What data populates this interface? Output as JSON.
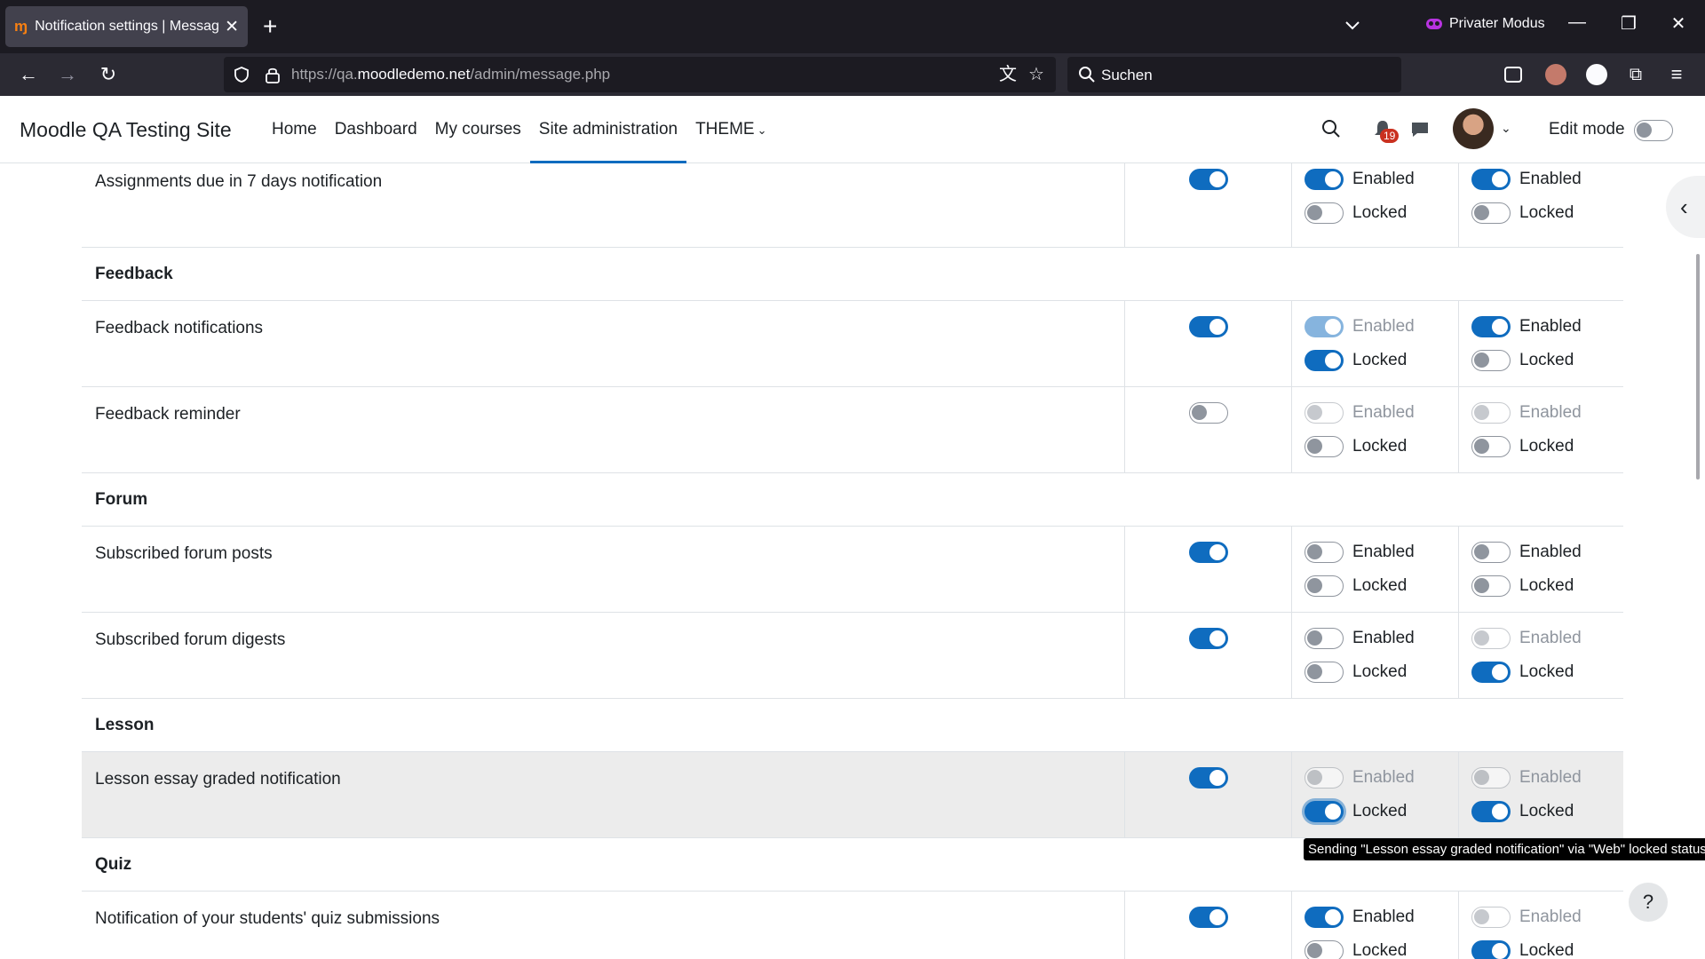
{
  "browser": {
    "tab_title": "Notification settings | Messagin",
    "tab_favicon": "moodle-m",
    "private_label": "Privater Modus",
    "url_prefix": "https://qa.",
    "url_domain": "moodledemo.net",
    "url_path": "/admin/message.php",
    "search_placeholder": "Suchen"
  },
  "moodle": {
    "site_name": "Moodle QA Testing Site",
    "nav": [
      "Home",
      "Dashboard",
      "My courses",
      "Site administration",
      "THEME"
    ],
    "active_nav": "Site administration",
    "notification_count": "19",
    "edit_mode_label": "Edit mode",
    "edit_mode_on": false
  },
  "labels": {
    "enabled": "Enabled",
    "locked": "Locked"
  },
  "rows": [
    {
      "type": "item",
      "label": "Assignments due in 7 days notification",
      "default": true,
      "p1": {
        "enabled": true,
        "locked": false,
        "disabled": false
      },
      "p2": {
        "enabled": true,
        "locked": false,
        "disabled": false
      }
    },
    {
      "type": "category",
      "label": "Feedback"
    },
    {
      "type": "item",
      "label": "Feedback notifications",
      "default": true,
      "p1": {
        "enabled": true,
        "locked": true,
        "disabled": true
      },
      "p2": {
        "enabled": true,
        "locked": false,
        "disabled": false
      }
    },
    {
      "type": "item",
      "label": "Feedback reminder",
      "default": false,
      "p1": {
        "enabled": false,
        "locked": false,
        "disabled": true
      },
      "p2": {
        "enabled": false,
        "locked": false,
        "disabled": true
      }
    },
    {
      "type": "category",
      "label": "Forum"
    },
    {
      "type": "item",
      "label": "Subscribed forum posts",
      "default": true,
      "p1": {
        "enabled": false,
        "locked": false,
        "disabled": false
      },
      "p2": {
        "enabled": false,
        "locked": false,
        "disabled": false
      }
    },
    {
      "type": "item",
      "label": "Subscribed forum digests",
      "default": true,
      "p1": {
        "enabled": false,
        "locked": false,
        "disabled": false
      },
      "p2": {
        "enabled": false,
        "locked": true,
        "disabled": true
      }
    },
    {
      "type": "category",
      "label": "Lesson"
    },
    {
      "type": "item",
      "label": "Lesson essay graded notification",
      "default": true,
      "hover": true,
      "p1": {
        "enabled": false,
        "locked": true,
        "disabled": true,
        "focus": true
      },
      "p2": {
        "enabled": false,
        "locked": true,
        "disabled": true
      }
    },
    {
      "type": "category",
      "label": "Quiz"
    },
    {
      "type": "item",
      "label": "Notification of your students' quiz submissions",
      "default": true,
      "p1": {
        "enabled": true,
        "locked": false,
        "disabled": false
      },
      "p2": {
        "enabled": false,
        "locked": true,
        "disabled": true
      }
    }
  ],
  "tooltip": "Sending \"Lesson essay graded notification\" via \"Web\" locked status",
  "help_label": "?"
}
